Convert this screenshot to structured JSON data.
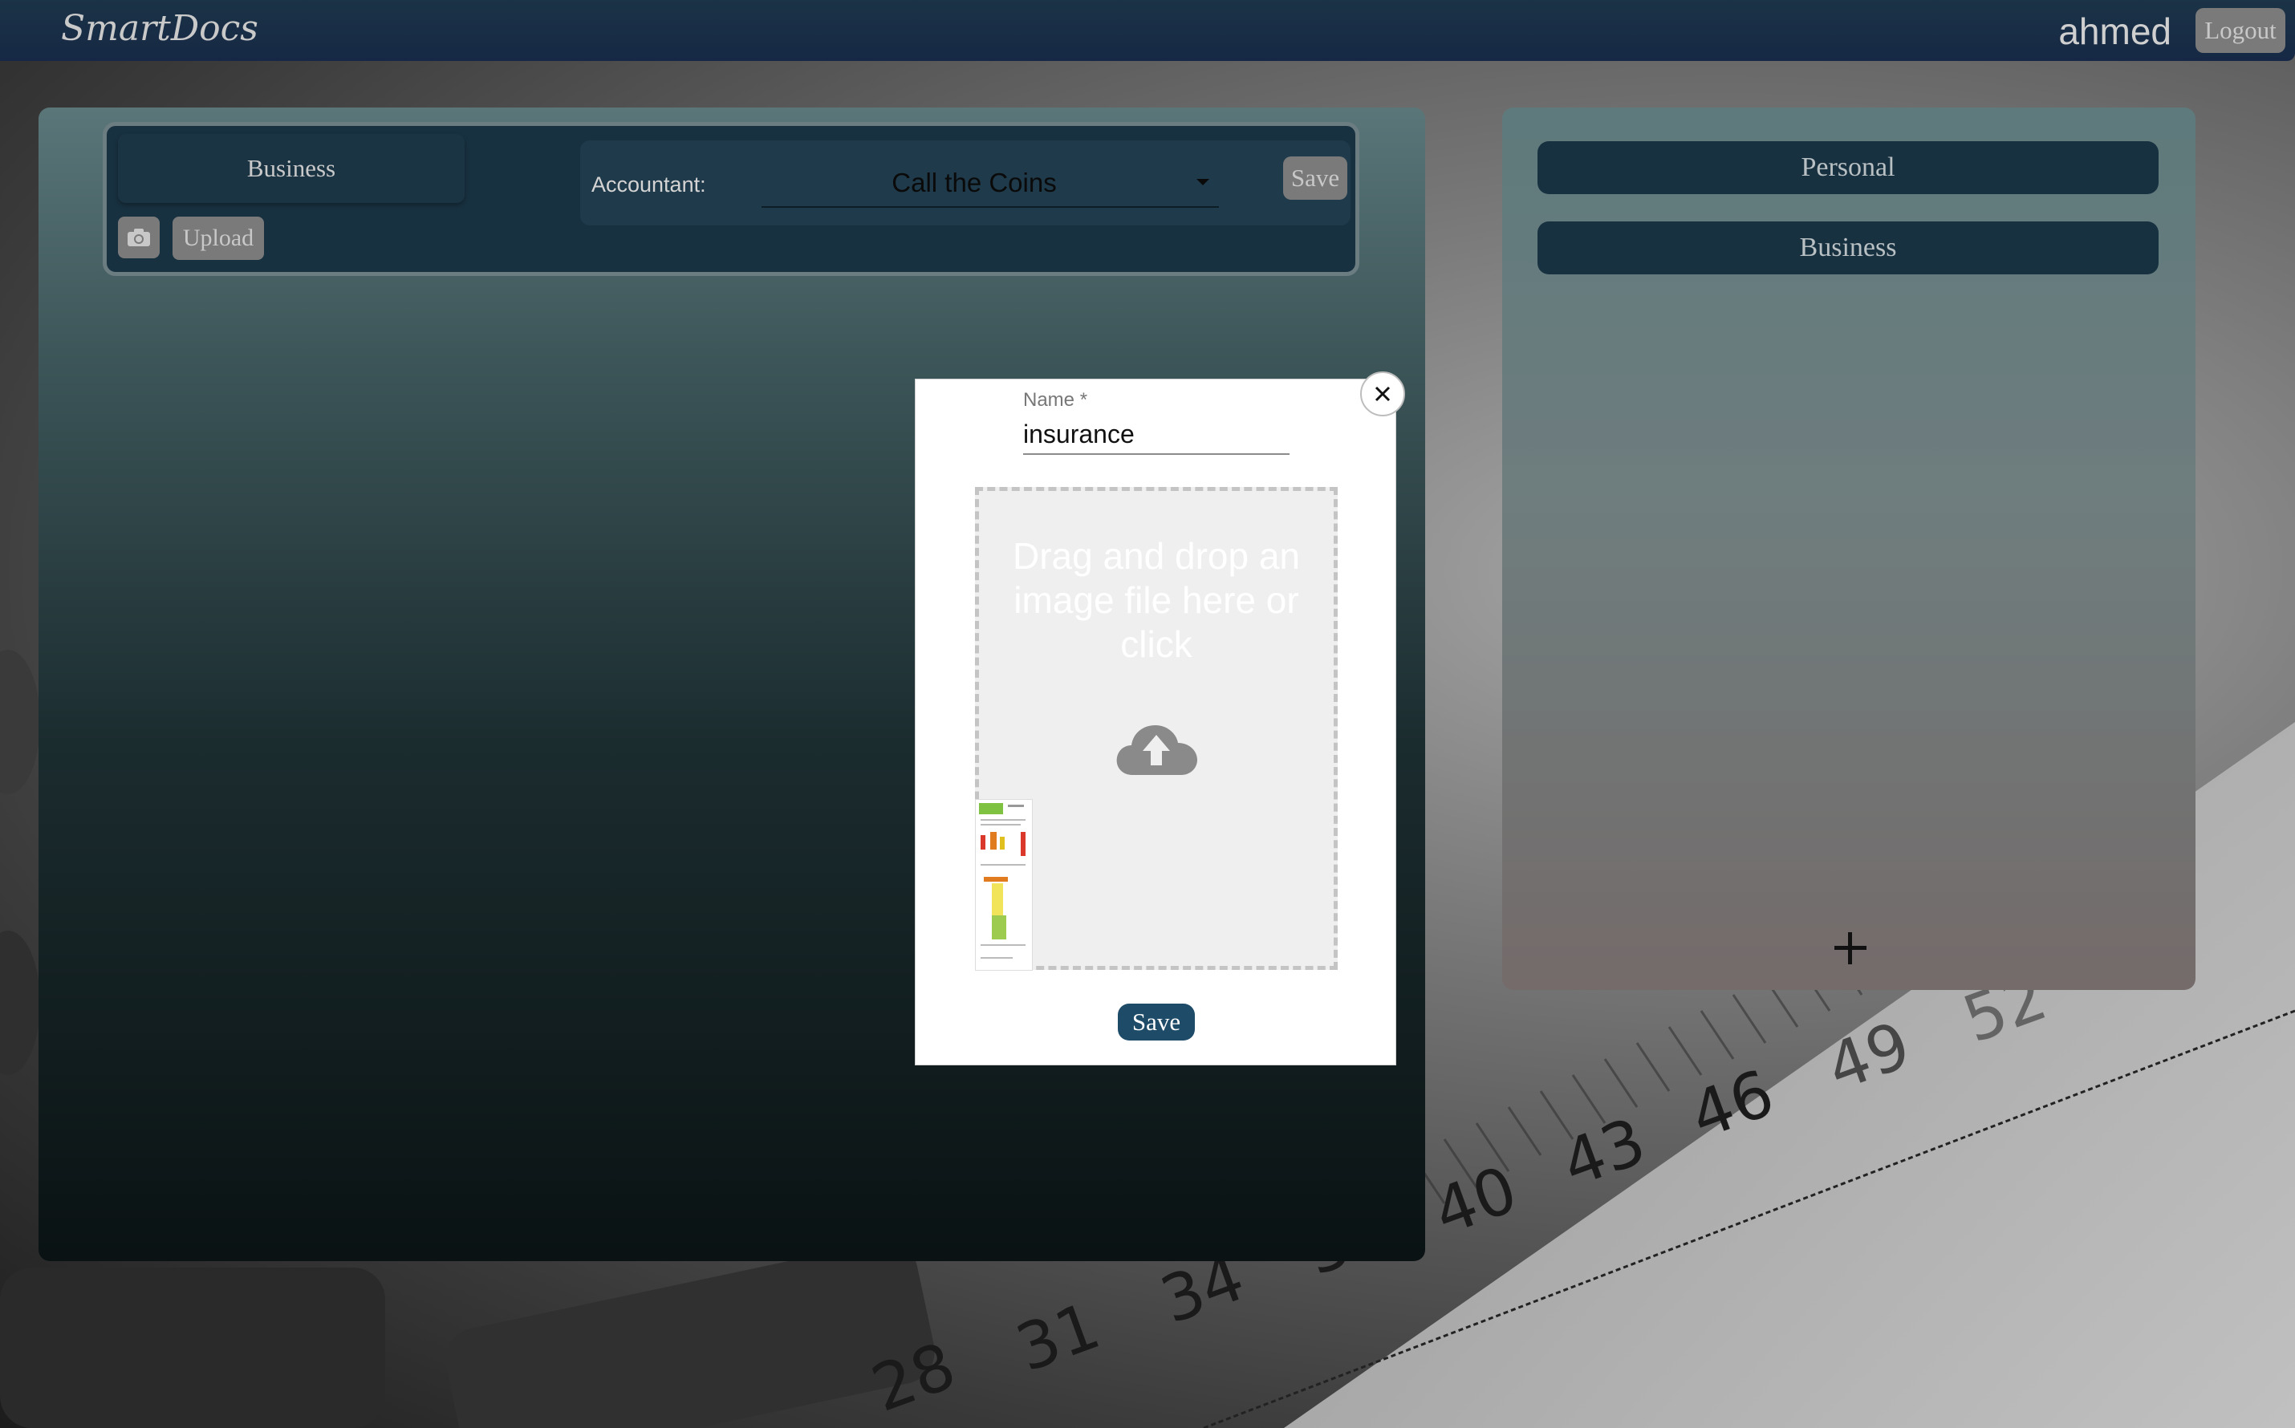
{
  "app": {
    "brand": "SmartDocs",
    "username": "ahmed",
    "logout_label": "Logout"
  },
  "toolbar": {
    "active_category": "Business",
    "upload_label": "Upload",
    "accountant_label": "Accountant:",
    "accountant_value": "Call the Coins",
    "save_label": "Save"
  },
  "categories": {
    "items": [
      "Personal",
      "Business"
    ]
  },
  "modal": {
    "name_label": "Name *",
    "name_value": "insurance",
    "dropzone_text": "Drag and drop an image file here or click",
    "save_label": "Save"
  },
  "background": {
    "numbers": [
      "28",
      "31",
      "34",
      "37",
      "40",
      "43",
      "46",
      "49",
      "52"
    ]
  },
  "colors": {
    "topbar": "#1b3346",
    "panel_dark": "#183140",
    "modal_save": "#1d4b68"
  }
}
